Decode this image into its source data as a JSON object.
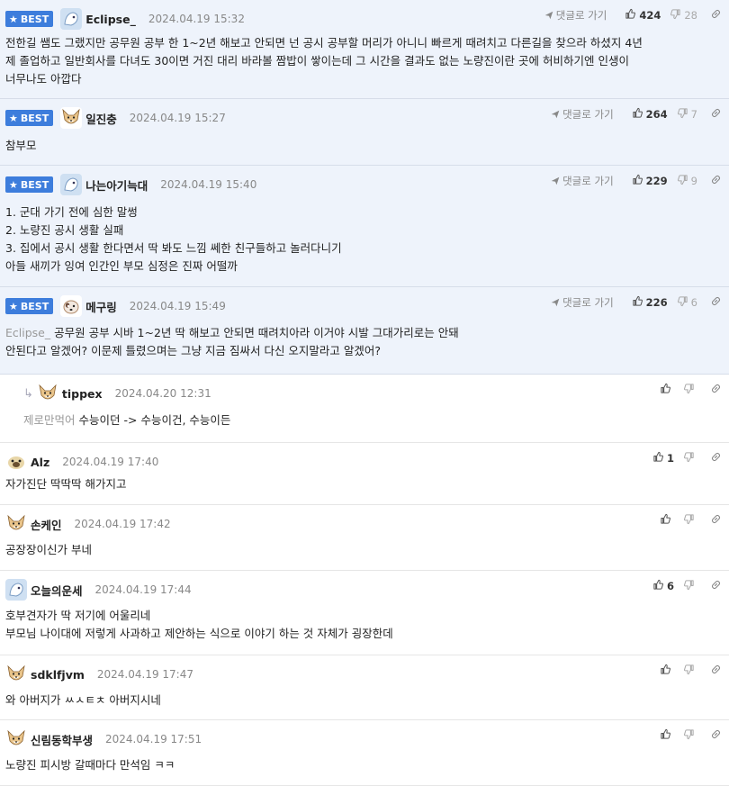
{
  "labels": {
    "best": "BEST",
    "reply_to": "댓글로 가기"
  },
  "comments": [
    {
      "best": true,
      "nick": "Eclipse_",
      "date": "2024.04.19 15:32",
      "up": "424",
      "down": "28",
      "mention": "",
      "body": "전한길 쌤도 그랬지만 공무원 공부 한 1~2년 해보고 안되면 넌 공시 공부할 머리가 아니니 빠르게 때려치고 다른길을 찾으라 하셨지 4년\n제 졸업하고 일반회사를 다녀도 30이면 거진 대리 바라볼 짬밥이 쌓이는데 그 시간을 결과도 없는 노량진이란 곳에 허비하기엔 인생이\n너무나도 아깝다"
    },
    {
      "best": true,
      "nick": "일진충",
      "date": "2024.04.19 15:27",
      "up": "264",
      "down": "7",
      "mention": "",
      "body": "참부모"
    },
    {
      "best": true,
      "nick": "나는아기늑대",
      "date": "2024.04.19 15:40",
      "up": "229",
      "down": "9",
      "mention": "",
      "body": "1. 군대 가기 전에 심한 말썽\n2. 노량진 공시 생활 실패\n3. 집에서 공시 생활 한다면서 딱 봐도 느낌 쎄한 친구들하고 놀러다니기\n아들 새끼가 잉여 인간인 부모 심정은 진짜 어떨까"
    },
    {
      "best": true,
      "nick": "메구링",
      "date": "2024.04.19 15:49",
      "up": "226",
      "down": "6",
      "mention": "Eclipse_",
      "body": "공무원 공부 시바 1~2년 딱 해보고 안되면 때려치아라 이거야 시발 그대가리로는 안돼\n안된다고 알겠어? 이문제 틀렸으며는 그냥 지금 짐싸서 다신 오지말라고 알겠어?"
    },
    {
      "best": false,
      "reply": true,
      "nick": "tippex",
      "date": "2024.04.20 12:31",
      "up": "",
      "down": "",
      "mention": "제로만먹어",
      "body": "수능이던 -> 수능이건, 수능이든"
    },
    {
      "best": false,
      "nick": "Alz",
      "date": "2024.04.19 17:40",
      "up": "1",
      "down": "",
      "mention": "",
      "body": "자가진단 딱딱딱 해가지고"
    },
    {
      "best": false,
      "nick": "손케인",
      "date": "2024.04.19 17:42",
      "up": "",
      "down": "",
      "mention": "",
      "body": "공장장이신가 부네"
    },
    {
      "best": false,
      "nick": "오늘의운세",
      "date": "2024.04.19 17:44",
      "up": "6",
      "down": "",
      "mention": "",
      "body": "호부견자가 딱 저기에 어울리네\n부모님 나이대에 저렇게 사과하고 제안하는 식으로 이야기 하는 것 자체가 굉장한데"
    },
    {
      "best": false,
      "nick": "sdklfjvm",
      "date": "2024.04.19 17:47",
      "up": "",
      "down": "",
      "mention": "",
      "body": "와 아버지가 ㅆㅅㅌㅊ 아버지시네"
    },
    {
      "best": false,
      "nick": "신림동학부생",
      "date": "2024.04.19 17:51",
      "up": "",
      "down": "",
      "mention": "",
      "body": "노량진 피시방 갈때마다 만석임 ㅋㅋ"
    }
  ],
  "icons": {
    "best": "star-icon",
    "reply": "paper-plane-icon",
    "up": "thumbs-up-icon",
    "down": "thumbs-down-icon",
    "share": "link-icon",
    "reply_arrow": "reply-arrow-icon"
  },
  "colors": {
    "best_bg": "#eef3fb",
    "badge": "#3d7ddc"
  }
}
